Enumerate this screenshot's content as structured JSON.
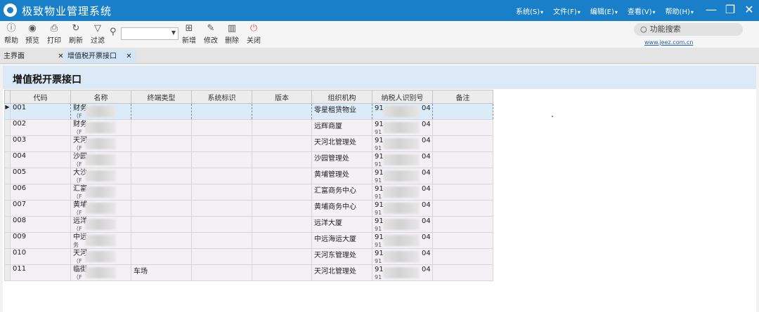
{
  "app": {
    "title": "极致物业管理系统",
    "menus": [
      "系统(S)",
      "文件(F)",
      "编辑(E)",
      "查看(V)",
      "帮助(H)"
    ],
    "window_controls": [
      "—",
      "❐",
      "✕"
    ]
  },
  "toolbar": {
    "help": "帮助",
    "preview": "预览",
    "print": "打印",
    "refresh": "刷新",
    "filter": "过滤",
    "filter_value": "",
    "add": "新增",
    "edit": "修改",
    "delete": "删除",
    "close": "关闭",
    "feature_search": "功能搜索",
    "site_link": "www.jeez.com.cn"
  },
  "tabs": [
    {
      "label": "主界面",
      "close": "✕"
    },
    {
      "label": "增值税开票接口",
      "close": "✕"
    }
  ],
  "page": {
    "title": "增值税开票接口"
  },
  "grid": {
    "columns": [
      "代码",
      "名称",
      "终端类型",
      "系统标识",
      "版本",
      "组织机构",
      "纳税人识别号",
      "备注"
    ],
    "rows": [
      {
        "code": "001",
        "name": "财务",
        "name2": "（F",
        "terminal": "",
        "sysid": "",
        "version": "",
        "org": "零星租赁物业",
        "tax1": "91",
        "tax1_end": "04",
        "tax2": "",
        "note": ""
      },
      {
        "code": "002",
        "name": "财务",
        "name2": "（F",
        "terminal": "",
        "sysid": "",
        "version": "",
        "org": "远辉商厦",
        "tax1": "91",
        "tax1_end": "04",
        "tax2": "91",
        "note": ""
      },
      {
        "code": "003",
        "name": "天河",
        "name2": "（F",
        "terminal": "",
        "sysid": "",
        "version": "",
        "org": "天河北管理处",
        "tax1": "91",
        "tax1_end": "04",
        "tax2": "91",
        "note": ""
      },
      {
        "code": "004",
        "name": "沙园",
        "name2": "（F",
        "terminal": "",
        "sysid": "",
        "version": "",
        "org": "沙园管理处",
        "tax1": "91",
        "tax1_end": "04",
        "tax2": "91",
        "note": ""
      },
      {
        "code": "005",
        "name": "大沙",
        "name2": "（F",
        "terminal": "",
        "sysid": "",
        "version": "",
        "org": "黄埔管理处",
        "tax1": "91",
        "tax1_end": "04",
        "tax2": "91",
        "note": ""
      },
      {
        "code": "006",
        "name": "汇富",
        "name2": "（F",
        "terminal": "",
        "sysid": "",
        "version": "",
        "org": "汇富商务中心",
        "tax1": "91",
        "tax1_end": "04",
        "tax2": "91",
        "note": ""
      },
      {
        "code": "007",
        "name": "黄埔",
        "name2": "（F",
        "terminal": "",
        "sysid": "",
        "version": "",
        "org": "黄埔商务中心",
        "tax1": "91",
        "tax1_end": "04",
        "tax2": "91",
        "note": ""
      },
      {
        "code": "008",
        "name": "远洋",
        "name2": "（F",
        "terminal": "",
        "sysid": "",
        "version": "",
        "org": "远洋大厦",
        "tax1": "91",
        "tax1_end": "04",
        "tax2": "91",
        "note": ""
      },
      {
        "code": "009",
        "name": "中远",
        "name2": "务",
        "terminal": "",
        "sysid": "",
        "version": "",
        "org": "中远海运大厦",
        "tax1": "91",
        "tax1_end": "04",
        "tax2": "91",
        "note": ""
      },
      {
        "code": "010",
        "name": "天河",
        "name2": "（F",
        "terminal": "",
        "sysid": "",
        "version": "",
        "org": "天河东管理处",
        "tax1": "91",
        "tax1_end": "04",
        "tax2": "91",
        "note": ""
      },
      {
        "code": "011",
        "name": "临街",
        "name2": "（F",
        "terminal": "车场",
        "sysid": "",
        "version": "",
        "org": "天河北管理处",
        "tax1": "91",
        "tax1_end": "04",
        "tax2": "91",
        "note": ""
      }
    ]
  }
}
